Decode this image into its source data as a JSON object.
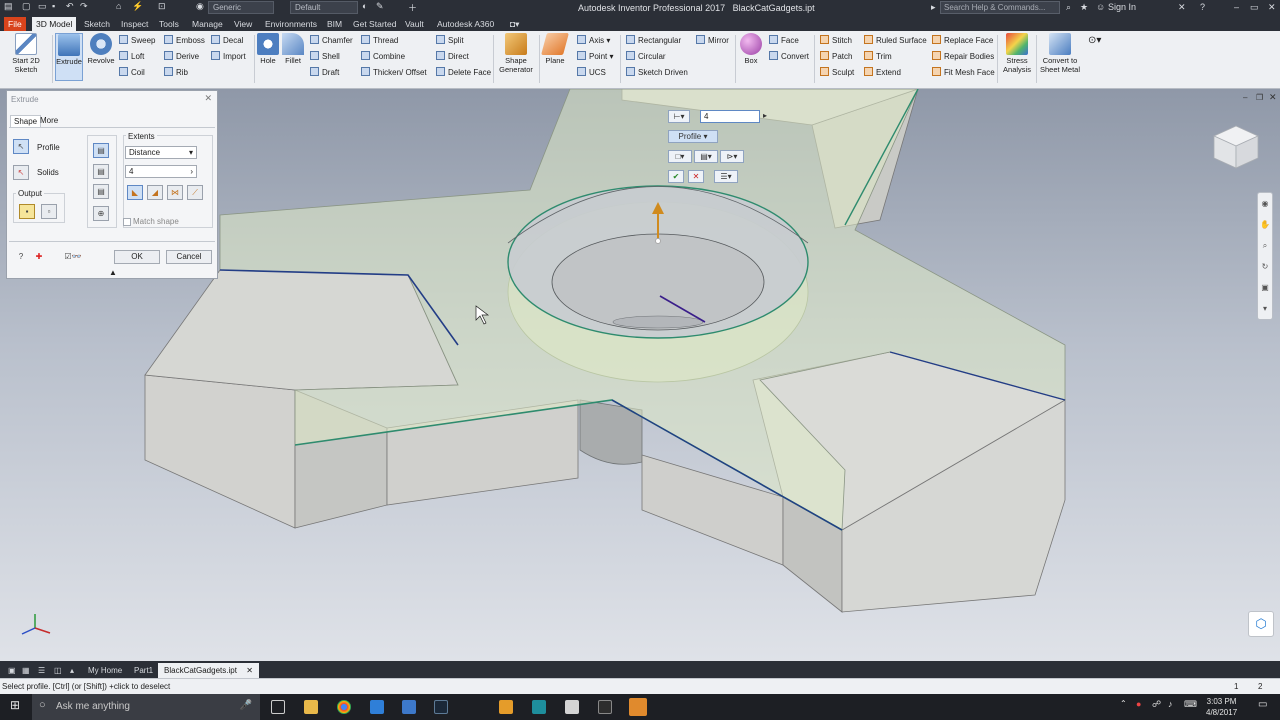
{
  "window": {
    "title": "Autodesk Inventor Professional 2017",
    "filename": "BlackCatGadgets.ipt",
    "appearance_combo": "Generic",
    "material_combo": "Default",
    "search_placeholder": "Search Help & Commands...",
    "signin": "Sign In"
  },
  "ribbon_tabs": [
    "File",
    "3D Model",
    "Sketch",
    "Inspect",
    "Tools",
    "Manage",
    "View",
    "Environments",
    "BIM",
    "Get Started",
    "Vault",
    "Autodesk A360"
  ],
  "ribbon": {
    "start_sketch": "Start 2D Sketch",
    "extrude": "Extrude",
    "revolve": "Revolve",
    "create_small": [
      "Sweep",
      "Loft",
      "Coil",
      "Emboss",
      "Derive",
      "Rib",
      "Decal",
      "Import"
    ],
    "hole": "Hole",
    "fillet": "Fillet",
    "modify_small": [
      "Chamfer",
      "Shell",
      "Draft",
      "Thread",
      "Combine",
      "Thicken/ Offset",
      "Split",
      "Direct",
      "Delete Face"
    ],
    "shape_generator": "Shape Generator",
    "plane": "Plane",
    "work_small": [
      "Axis",
      "Point",
      "UCS"
    ],
    "pattern_small": [
      "Rectangular",
      "Circular",
      "Sketch Driven",
      "Mirror"
    ],
    "box": "Box",
    "freeform_small": [
      "Face",
      "Convert"
    ],
    "surface_small": [
      "Stitch",
      "Patch",
      "Sculpt",
      "Ruled Surface",
      "Trim",
      "Extend",
      "Replace Face",
      "Repair Bodies",
      "Fit Mesh Face"
    ],
    "stress_analysis": "Stress Analysis",
    "convert_sheet_metal": "Convert to Sheet Metal"
  },
  "extrude_dialog": {
    "title": "Extrude",
    "tabs": [
      "Shape",
      "More"
    ],
    "profile_label": "Profile",
    "solids_label": "Solids",
    "output_label": "Output",
    "extents_label": "Extents",
    "extents_value": "Distance",
    "distance_value": "4",
    "match_shape": "Match shape",
    "ok": "OK",
    "cancel": "Cancel"
  },
  "mini_toolbar": {
    "distance_value": "4",
    "profile_label": "Profile"
  },
  "doc_tabs": [
    "My Home",
    "Part1",
    "BlackCatGadgets.ipt"
  ],
  "status": {
    "prompt": "Select profile. [Ctrl] (or [Shift]) +click to deselect",
    "count_a": "1",
    "count_b": "2"
  },
  "taskbar": {
    "search_placeholder": "Ask me anything",
    "time": "3:03 PM",
    "date": "4/8/2017"
  },
  "colors": {
    "file_tab": "#d8441c",
    "selection_edge": "#1f8a6a",
    "preview_fill": "#dfe9c6"
  }
}
